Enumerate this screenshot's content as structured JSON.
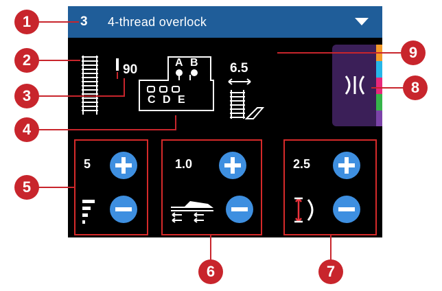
{
  "header": {
    "stitch_number": "3",
    "stitch_name": "4-thread overlock",
    "dropdown_icon": "triangle-down-icon"
  },
  "info": {
    "presser_foot_icon": "overlock-stitch-icon",
    "needle_icon": "needle-icon",
    "needle_size": "90",
    "threading": {
      "top": [
        "A",
        "B"
      ],
      "bottom": [
        "C",
        "D",
        "E"
      ]
    },
    "stitch_width": "6.5",
    "width_icon": "stitch-width-overlock-icon"
  },
  "side_tab": {
    "icon": "stitch-options-icon",
    "strip_colors": [
      "#f39a2b",
      "#26b6e8",
      "#e8287a",
      "#36b34a",
      "#7b43a8"
    ]
  },
  "controls": [
    {
      "value": "5",
      "icon": "thread-tension-icon"
    },
    {
      "value": "1.0",
      "icon": "differential-feed-icon"
    },
    {
      "value": "2.5",
      "icon": "stitch-length-icon"
    }
  ],
  "callouts": [
    "1",
    "2",
    "3",
    "4",
    "5",
    "6",
    "7",
    "8",
    "9"
  ],
  "colors": {
    "header": "#1f5d99",
    "accent_button": "#3e8fe0",
    "callout": "#c8252c",
    "highlight_frame": "#d62a2a"
  }
}
